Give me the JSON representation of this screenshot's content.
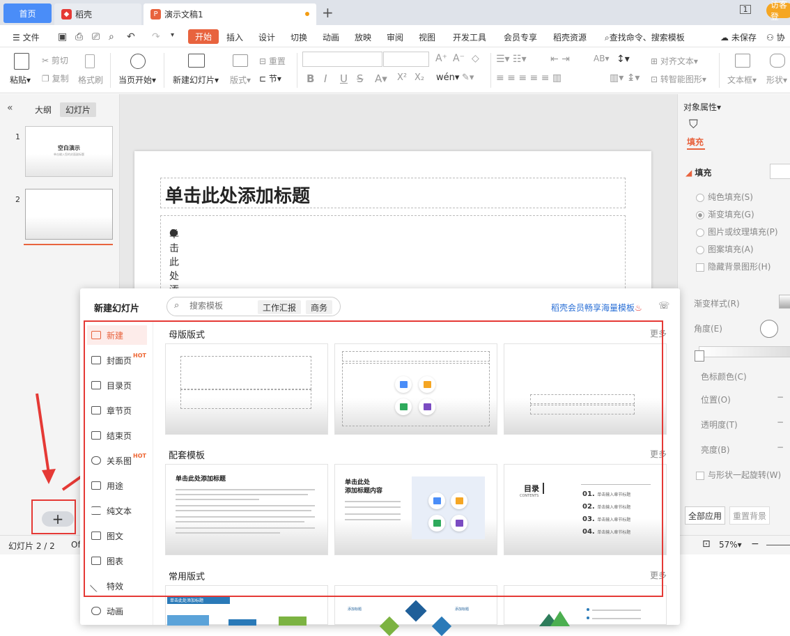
{
  "tabs": {
    "home": "首页",
    "daoke": "稻壳",
    "doc": "演示文稿1"
  },
  "visitor": "访客登",
  "win_box": "1",
  "menu": {
    "file": "文件",
    "items": [
      "开始",
      "插入",
      "设计",
      "切换",
      "动画",
      "放映",
      "审阅",
      "视图",
      "开发工具",
      "会员专享",
      "稻壳资源"
    ],
    "search": "查找命令、搜索模板",
    "unsaved": "未保存",
    "collab": "协"
  },
  "toolbar": {
    "paste": "粘贴",
    "cut": "剪切",
    "copy": "复制",
    "format_painter": "格式刷",
    "play_current": "当页开始",
    "new_slide": "新建幻灯片",
    "layout": "版式",
    "section": "节",
    "reset": "重置",
    "align_text": "对齐文本",
    "smart_shape": "转智能图形",
    "text_box": "文本框",
    "shape": "形状"
  },
  "left": {
    "outline": "大纲",
    "slides": "幻灯片",
    "thumbs": [
      {
        "num": "1",
        "title": "空白演示",
        "sub": "单击输入您的封面副标题"
      },
      {
        "num": "2"
      }
    ]
  },
  "slide": {
    "title": "单击此处添加标题",
    "body": "单击此处添加文本"
  },
  "right": {
    "header": "对象属性",
    "tab": "填充",
    "section": "填充",
    "options": [
      "纯色填充(S)",
      "渐变填充(G)",
      "图片或纹理填充(P)",
      "图案填充(A)"
    ],
    "hide_bg": "隐藏背景图形(H)",
    "grad_style": "渐变样式(R)",
    "angle": "角度(E)",
    "stop_color": "色标颜色(C)",
    "position": "位置(O)",
    "transparency": "透明度(T)",
    "brightness": "亮度(B)",
    "rotate_with": "与形状一起旋转(W)",
    "apply_all": "全部应用",
    "reset_bg": "重置背景"
  },
  "status": {
    "slide": "幻灯片 2 / 2",
    "of": "Of",
    "zoom": "57%"
  },
  "popup": {
    "title": "新建幻灯片",
    "search_placeholder": "搜索模板",
    "tags": [
      "工作汇报",
      "商务"
    ],
    "promo": "稻壳会员畅享海量模板",
    "categories": [
      "新建",
      "封面页",
      "目录页",
      "章节页",
      "结束页",
      "关系图",
      "用途",
      "纯文本",
      "图文",
      "图表",
      "特效",
      "动画"
    ],
    "hot": "HOT",
    "sections": [
      "母版版式",
      "配套模板",
      "常用版式"
    ],
    "more": "更多",
    "t_title1": "单击此处添加标题",
    "t_title2a": "单击此处",
    "t_title2b": "添加标题内容",
    "toc": {
      "title": "目录",
      "sub": "CONTENTS",
      "items": [
        "01.",
        "02.",
        "03.",
        "04."
      ],
      "placeholder": "单击输入章节标题"
    },
    "c1_title": "单击此处添加标题",
    "c2_label": "添加标题"
  },
  "colors": {
    "accent": "#e8633e",
    "brand": "#4a8df8",
    "annotation": "#e53935"
  }
}
